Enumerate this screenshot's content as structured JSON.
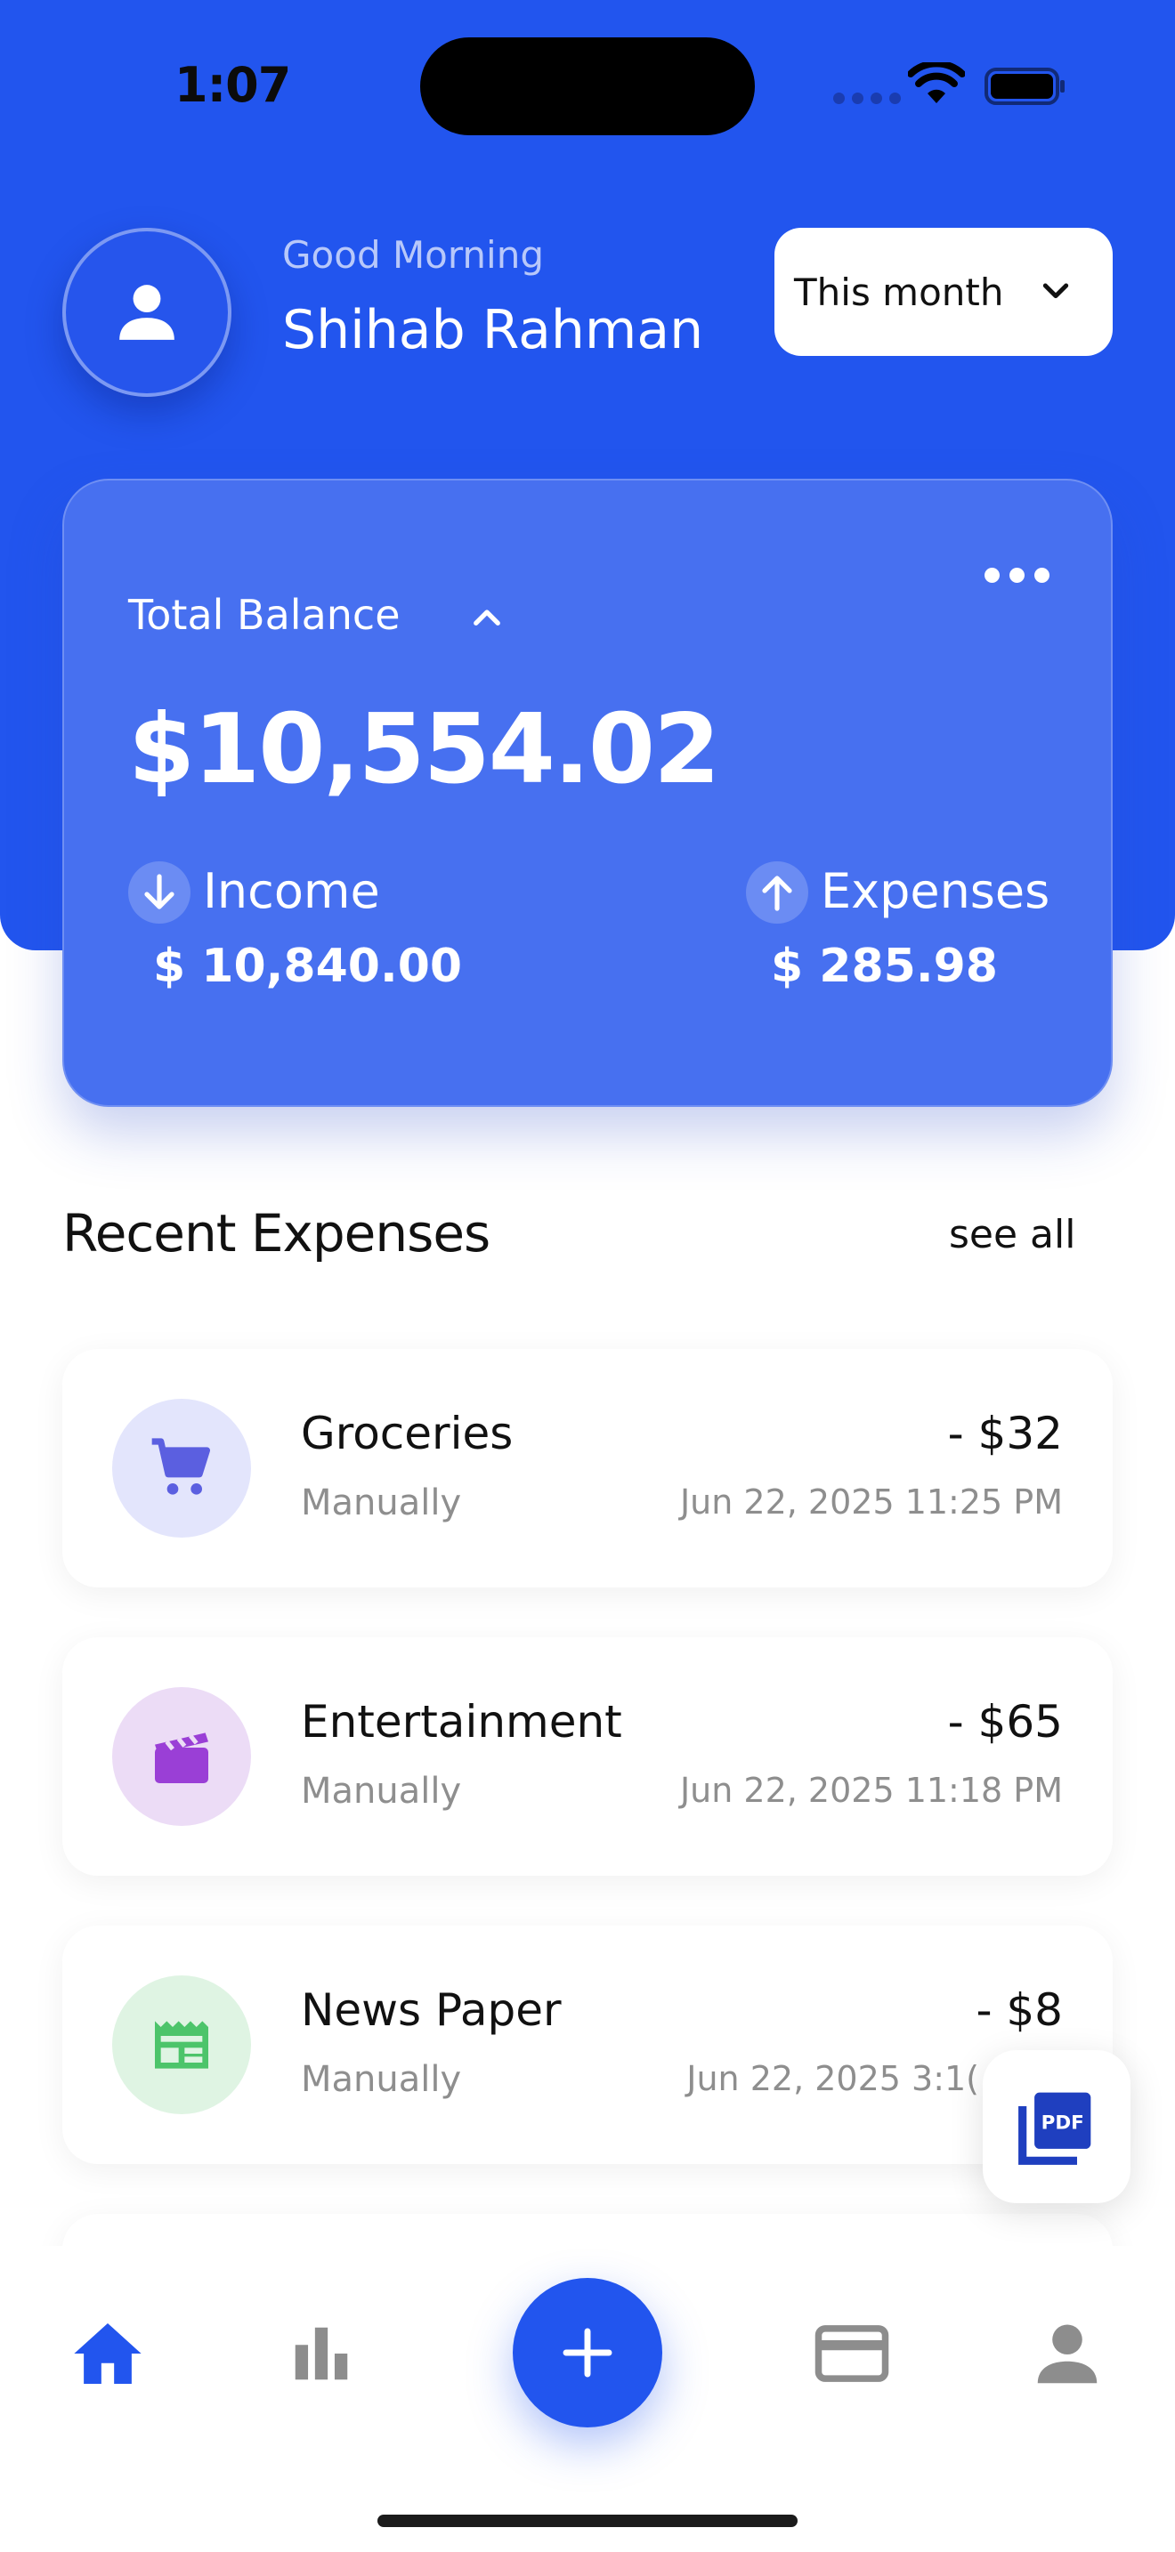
{
  "status_bar": {
    "time": "1:07"
  },
  "header": {
    "greeting": "Good Morning",
    "user_name": "Shihab Rahman",
    "period_selector": {
      "selected": "This month"
    }
  },
  "balance": {
    "label": "Total Balance",
    "amount": "$10,554.02",
    "income": {
      "label": "Income",
      "value": "$ 10,840.00"
    },
    "expenses": {
      "label": "Expenses",
      "value": "$ 285.98"
    }
  },
  "recent_expenses": {
    "title": "Recent Expenses",
    "see_all": "see all",
    "items": [
      {
        "name": "Groceries",
        "source": "Manually",
        "amount": "- $32",
        "date": "Jun 22, 2025 11:25 PM",
        "icon": "cart-icon",
        "icon_color": "#5b5fe0",
        "icon_bg": "#e3e5fc"
      },
      {
        "name": "Entertainment",
        "source": "Manually",
        "amount": "- $65",
        "date": "Jun 22, 2025 11:18 PM",
        "icon": "clapperboard-icon",
        "icon_color": "#9a3fd6",
        "icon_bg": "#ecdcf6"
      },
      {
        "name": "News Paper",
        "source": "Manually",
        "amount": "- $8",
        "date": "Jun 22, 2025 3:1(",
        "icon": "newspaper-icon",
        "icon_color": "#4cc46a",
        "icon_bg": "#dff4e3"
      }
    ]
  },
  "pdf_button": {
    "icon": "pdf-icon",
    "text": "PDF"
  },
  "bottom_nav": {
    "items": [
      {
        "name": "home",
        "icon": "home-icon",
        "active": true
      },
      {
        "name": "stats",
        "icon": "bar-chart-icon",
        "active": false
      },
      {
        "name": "add",
        "icon": "plus-icon",
        "active": false
      },
      {
        "name": "cards",
        "icon": "credit-card-icon",
        "active": false
      },
      {
        "name": "profile",
        "icon": "person-icon",
        "active": false
      }
    ]
  },
  "colors": {
    "primary": "#2255ee",
    "card": "#4770f0",
    "muted": "#8e8e8e"
  }
}
